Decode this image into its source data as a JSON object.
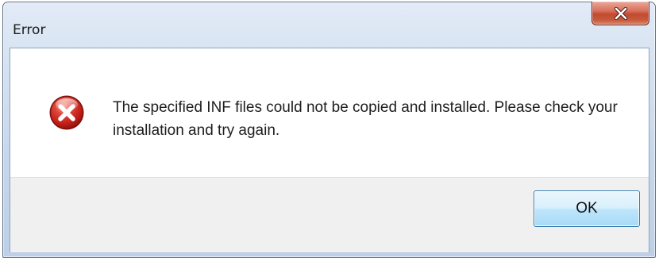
{
  "window": {
    "title": "Error"
  },
  "dialog": {
    "icon": "error-icon",
    "message": "The specified INF files could not be copied and installed. Please check your installation and try again.",
    "ok_label": "OK"
  },
  "colors": {
    "error_red": "#d1261e",
    "close_button": "#c8553a",
    "button_border": "#3c7fb1"
  }
}
